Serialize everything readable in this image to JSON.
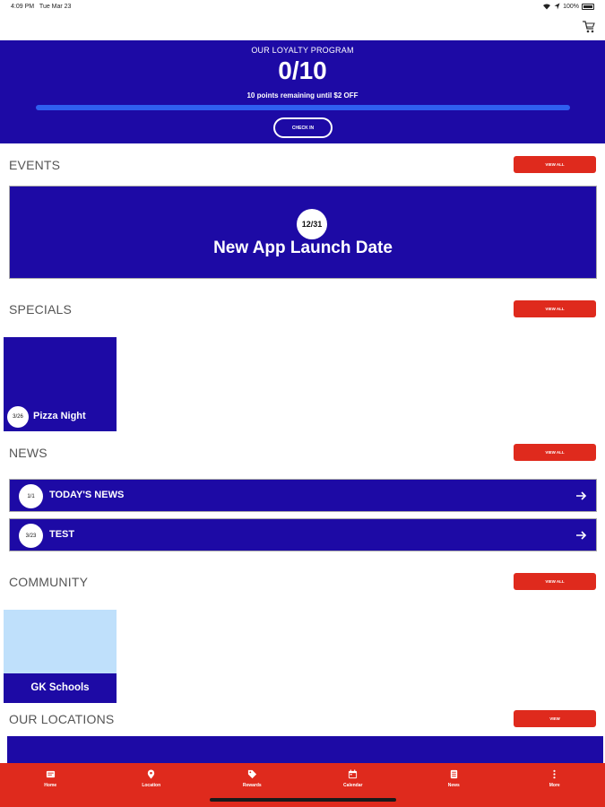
{
  "status_bar": {
    "time": "4:09 PM",
    "date": "Tue Mar 23",
    "battery": "100%"
  },
  "loyalty": {
    "label": "OUR LOYALTY PROGRAM",
    "count": "0/10",
    "remaining": "10 points remaining until $2 OFF",
    "progress": 0,
    "checkin_label": "CHECK IN",
    "bg_color": "#1d0aa5"
  },
  "events": {
    "title": "EVENTS",
    "view_all_label": "VIEW ALL",
    "item": {
      "date": "12/31",
      "title": "New App Launch Date"
    }
  },
  "specials": {
    "title": "SPECIALS",
    "view_all_label": "VIEW ALL",
    "item": {
      "date": "3/26",
      "title": "Pizza Night"
    }
  },
  "news": {
    "title": "NEWS",
    "view_all_label": "VIEW ALL",
    "items": [
      {
        "date": "1/1",
        "title": "TODAY'S NEWS"
      },
      {
        "date": "3/23",
        "title": "TEST"
      }
    ]
  },
  "community": {
    "title": "COMMUNITY",
    "view_all_label": "VIEW ALL",
    "item": {
      "title": "GK Schools"
    }
  },
  "locations": {
    "title": "OUR LOCATIONS",
    "view_label": "VIEW"
  },
  "tab_bar": {
    "items": [
      {
        "label": "Home",
        "icon": "home-icon"
      },
      {
        "label": "Location",
        "icon": "location-pin-icon"
      },
      {
        "label": "Rewards",
        "icon": "tag-icon"
      },
      {
        "label": "Calendar",
        "icon": "calendar-icon"
      },
      {
        "label": "News",
        "icon": "news-icon"
      },
      {
        "label": "More",
        "icon": "more-vertical-icon"
      }
    ],
    "bg_color": "#df2a1d"
  },
  "colors": {
    "primary_blue": "#1d0aa5",
    "accent_red": "#df2a1d",
    "light_blue": "#bfe0fb"
  }
}
